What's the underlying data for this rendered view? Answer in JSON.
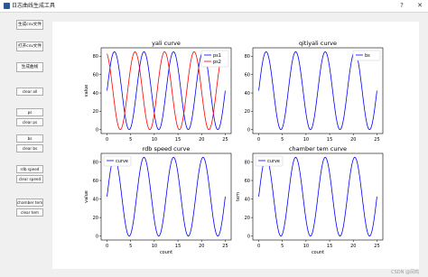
{
  "window": {
    "title": "日志曲线生成工具",
    "help_glyph": "?",
    "close_glyph": "✕"
  },
  "sidebar": {
    "buttons": [
      {
        "label": "生成csv文件"
      },
      {
        "label": "打开csv文件"
      },
      {
        "label": "生成曲线"
      },
      {
        "label": "clear all"
      },
      {
        "label": "ps"
      },
      {
        "label": "clear ps"
      },
      {
        "label": "bs"
      },
      {
        "label": "clear bs"
      },
      {
        "label": "rdb speed"
      },
      {
        "label": "clear speed"
      },
      {
        "label": "chamber tem"
      },
      {
        "label": "clear tem"
      }
    ]
  },
  "chart_data": [
    {
      "type": "line",
      "title": "yali  curve",
      "xlabel": "",
      "ylabel": "value",
      "xlim": [
        -1.25,
        26.25
      ],
      "ylim": [
        -4.25,
        89.25
      ],
      "xticks": [
        0,
        5,
        10,
        15,
        20,
        25
      ],
      "yticks": [
        0,
        20,
        40,
        60,
        80
      ],
      "legend": "top-right",
      "series": [
        {
          "name": "ps1",
          "color": "#0000ff",
          "amplitude": 42.5,
          "offset": 42.5,
          "period": 6.25,
          "phase": 0,
          "x_end": 25
        },
        {
          "name": "ps2",
          "color": "#ff0000",
          "amplitude": 42.5,
          "offset": 42.5,
          "period": 6.25,
          "phase": 1.9,
          "x_end": 25
        }
      ]
    },
    {
      "type": "line",
      "title": "qitiyali  curve",
      "xlabel": "",
      "ylabel": "",
      "xlim": [
        -1.25,
        26.25
      ],
      "ylim": [
        -4.25,
        89.25
      ],
      "xticks": [
        0,
        5,
        10,
        15,
        20,
        25
      ],
      "yticks": [
        0,
        20,
        40,
        60,
        80
      ],
      "legend": "top-right",
      "series": [
        {
          "name": "bs",
          "color": "#0000ff",
          "amplitude": 42.5,
          "offset": 42.5,
          "period": 6.25,
          "phase": 0,
          "x_end": 25
        }
      ]
    },
    {
      "type": "line",
      "title": "rdb speed  curve",
      "xlabel": "count",
      "ylabel": "value",
      "xlim": [
        -1.25,
        26.25
      ],
      "ylim": [
        -4.25,
        89.25
      ],
      "xticks": [
        0,
        5,
        10,
        15,
        20,
        25
      ],
      "yticks": [
        0,
        20,
        40,
        60,
        80
      ],
      "legend": "top-left",
      "series": [
        {
          "name": "curve",
          "color": "#0000ff",
          "amplitude": 42.5,
          "offset": 42.5,
          "period": 6.25,
          "phase": 0,
          "x_end": 25
        }
      ]
    },
    {
      "type": "line",
      "title": "chamber tem  curve",
      "xlabel": "count",
      "ylabel": "tem",
      "xlim": [
        -1.25,
        26.25
      ],
      "ylim": [
        -4.25,
        89.25
      ],
      "xticks": [
        0,
        5,
        10,
        15,
        20,
        25
      ],
      "yticks": [
        0,
        20,
        40,
        60,
        80
      ],
      "legend": "top-left",
      "series": [
        {
          "name": "curve",
          "color": "#0000ff",
          "amplitude": 42.5,
          "offset": 42.5,
          "period": 6.25,
          "phase": 0,
          "x_end": 25
        }
      ]
    }
  ],
  "watermark": "CSDN @凤鸣 "
}
